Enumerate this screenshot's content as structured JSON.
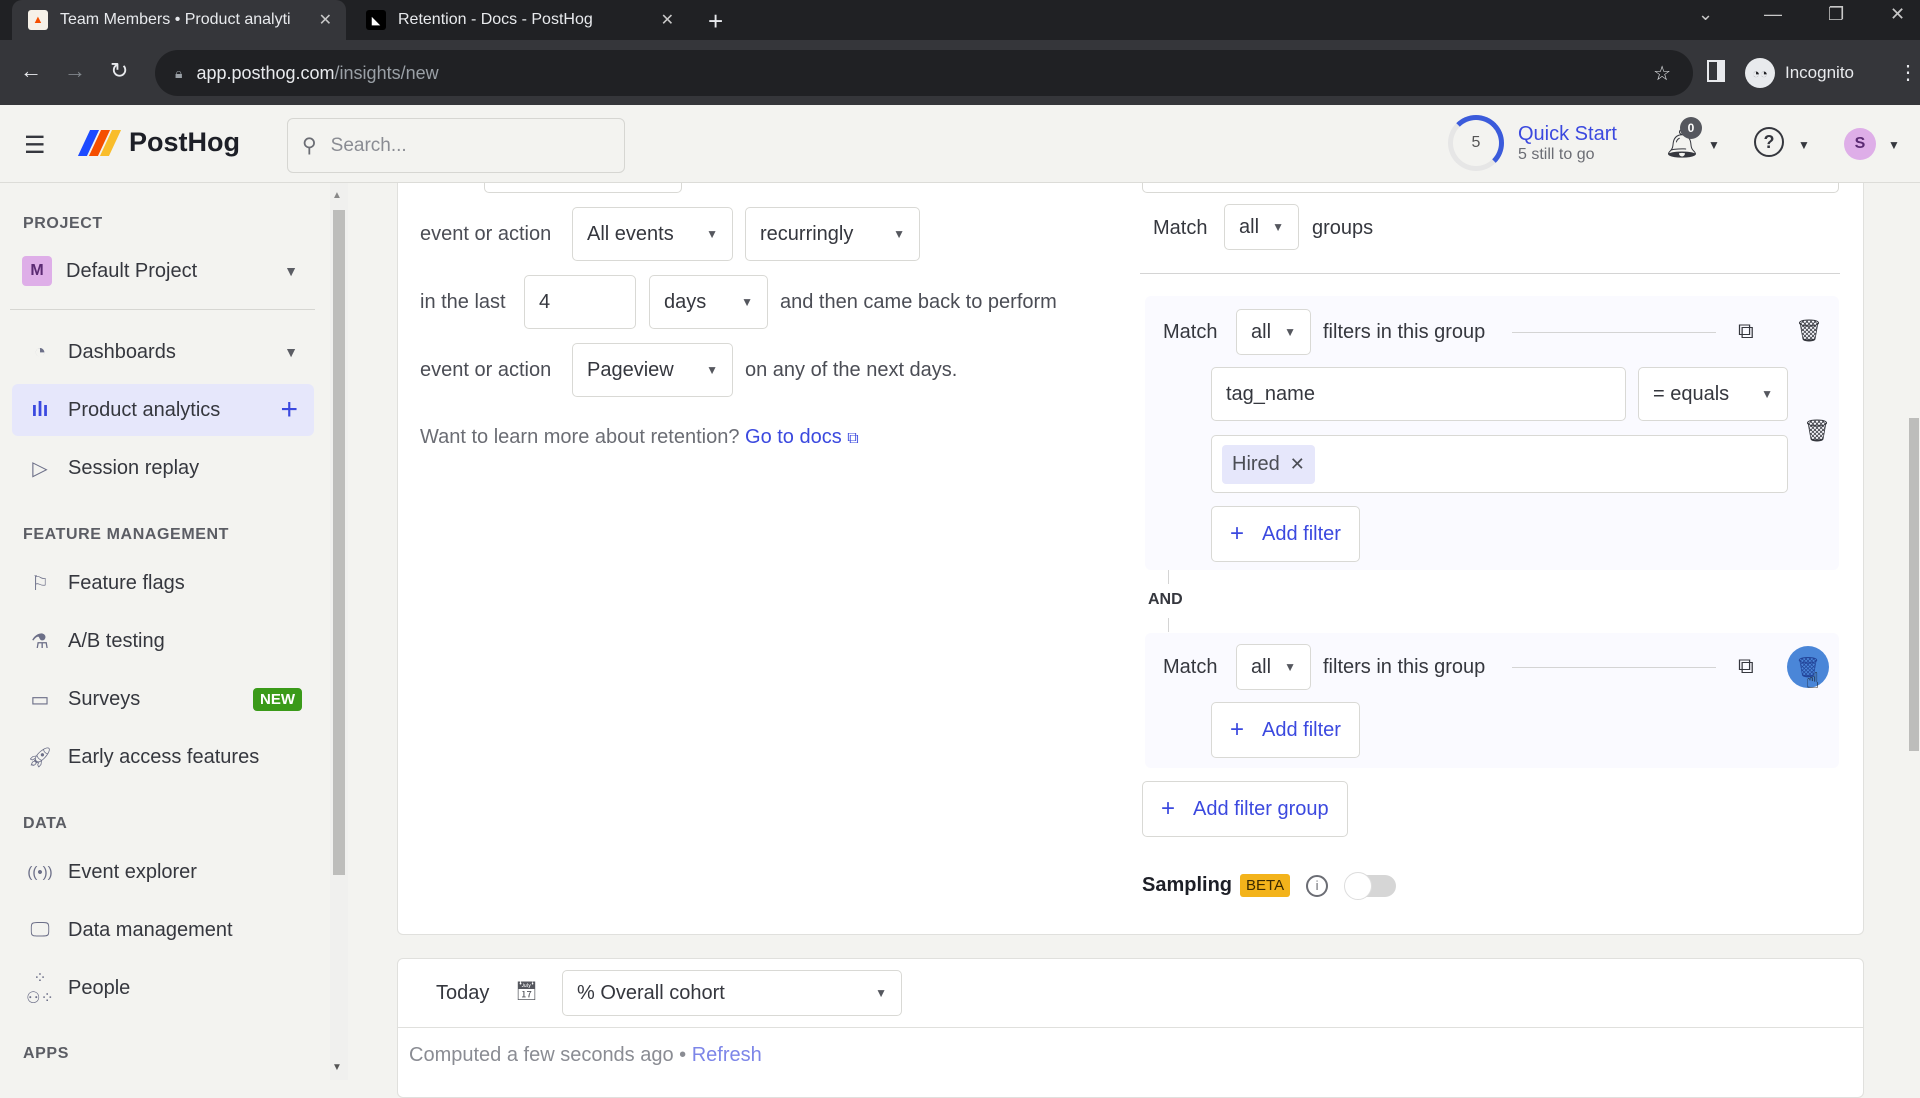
{
  "browser": {
    "tabs": [
      {
        "title": "Team Members • Product analyti",
        "active": true
      },
      {
        "title": "Retention - Docs - PostHog",
        "active": false
      }
    ],
    "url_host": "app.posthog.com",
    "url_path": "/insights/new",
    "profile_label": "Incognito"
  },
  "header": {
    "brand": "PostHog",
    "search_placeholder": "Search...",
    "quick_start": {
      "count": "5",
      "title": "Quick Start",
      "subtitle": "5 still to go",
      "progress_color": "#3b5bdb"
    },
    "notifications_count": "0",
    "avatar_initial": "S"
  },
  "sidebar": {
    "project_section": "PROJECT",
    "project": {
      "initial": "M",
      "name": "Default Project"
    },
    "items": [
      {
        "label": "Dashboards",
        "icon": "gauge-icon"
      },
      {
        "label": "Product analytics",
        "icon": "bar-chart-icon",
        "active": true
      },
      {
        "label": "Session replay",
        "icon": "play-icon"
      }
    ],
    "feature_section": "FEATURE MANAGEMENT",
    "feature_items": [
      {
        "label": "Feature flags",
        "icon": "flag-icon"
      },
      {
        "label": "A/B testing",
        "icon": "flask-icon"
      },
      {
        "label": "Surveys",
        "icon": "survey-icon",
        "badge": "NEW"
      },
      {
        "label": "Early access features",
        "icon": "rocket-icon"
      }
    ],
    "data_section": "DATA",
    "data_items": [
      {
        "label": "Event explorer",
        "icon": "broadcast-icon"
      },
      {
        "label": "Data management",
        "icon": "database-icon"
      },
      {
        "label": "People",
        "icon": "people-icon"
      }
    ],
    "apps_section": "APPS"
  },
  "retention": {
    "row1_label": "event or action",
    "target_event": "All events",
    "recurrence": "recurringly",
    "row2_label": "in the last",
    "period_value": "4",
    "period_unit": "days",
    "row2_suffix": "and then came back to perform",
    "row3_label": "event or action",
    "returning_event": "Pageview",
    "row3_suffix": "on any of the next days.",
    "docs_prompt": "Want to learn more about retention?",
    "docs_link": "Go to docs"
  },
  "filters": {
    "match_label": "Match",
    "match_groups_value": "all",
    "groups_label": "groups",
    "groups": [
      {
        "match_value": "all",
        "suffix": "filters in this group",
        "filters": [
          {
            "property": "tag_name",
            "operator": "= equals",
            "values": [
              "Hired"
            ]
          }
        ],
        "add_filter": "Add filter"
      },
      {
        "match_value": "all",
        "suffix": "filters in this group",
        "filters": [],
        "add_filter": "Add filter"
      }
    ],
    "and_label": "AND",
    "add_filter_group": "Add filter group",
    "sampling_label": "Sampling",
    "sampling_badge": "BETA",
    "sampling_enabled": false
  },
  "results": {
    "date_label": "Today",
    "display_mode": "% Overall cohort",
    "computed_text": "Computed a few seconds ago •",
    "refresh": "Refresh"
  }
}
